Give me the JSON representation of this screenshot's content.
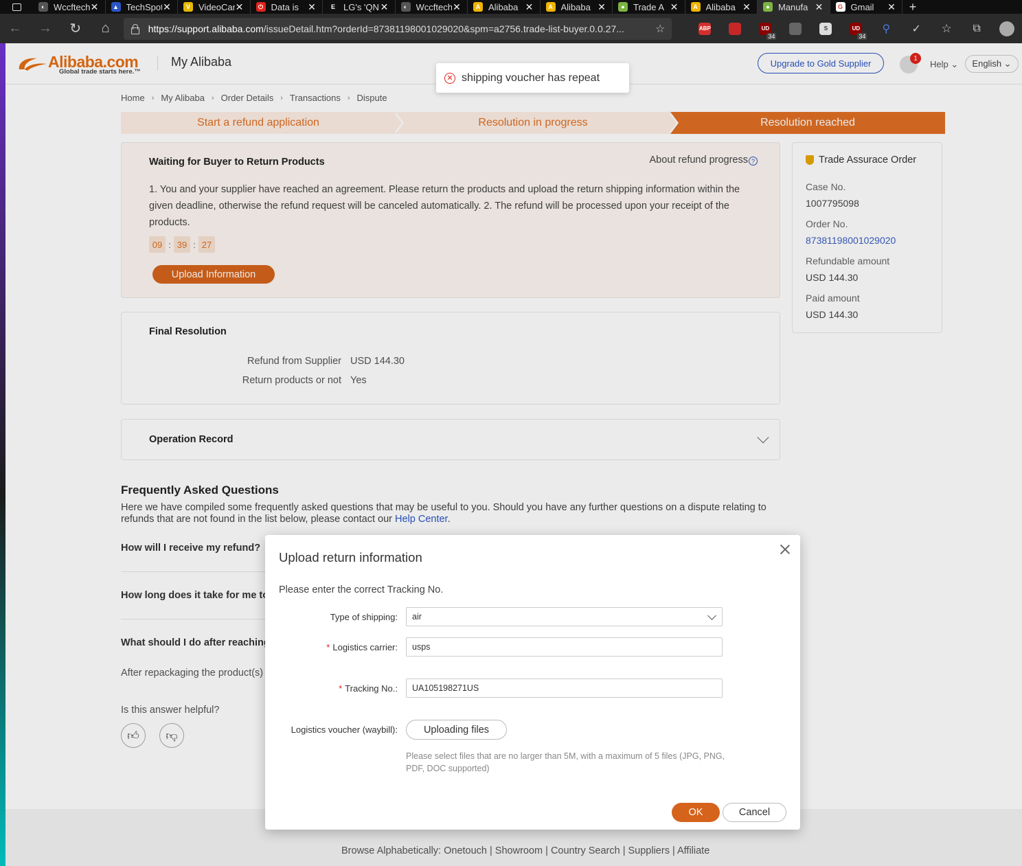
{
  "browser": {
    "tabs": [
      {
        "title": "Wccftech",
        "icon_color": "#555555",
        "glyph": "◐"
      },
      {
        "title": "TechSpot",
        "icon_color": "#2b55c3",
        "glyph": "▲"
      },
      {
        "title": "VideoCardz",
        "icon_color": "#e6b800",
        "glyph": "V"
      },
      {
        "title": "Data is",
        "icon_color": "#e2231a",
        "glyph": "⏻"
      },
      {
        "title": "LG's 'QNED'",
        "icon_color": "#111111",
        "glyph": "E"
      },
      {
        "title": "Wccftech",
        "icon_color": "#555555",
        "glyph": "◐"
      },
      {
        "title": "Alibaba",
        "icon_color": "#f0b400",
        "glyph": "A"
      },
      {
        "title": "Alibaba",
        "icon_color": "#f0b400",
        "glyph": "A"
      },
      {
        "title": "Trade A",
        "icon_color": "#7cb342",
        "glyph": "●"
      },
      {
        "title": "Alibaba",
        "icon_color": "#f0b400",
        "glyph": "A"
      },
      {
        "title": "Manufa",
        "icon_color": "#7cb342",
        "glyph": "●",
        "active": true
      },
      {
        "title": "Gmail",
        "icon_color": "#ffffff",
        "glyph": "G"
      }
    ],
    "url_host": "https://support.alibaba.com",
    "url_path": "/issueDetail.htm?orderId=87381198001029020&spm=a2756.trade-list-buyer.0.0.27...",
    "extensions": [
      {
        "name": "ABP",
        "color": "#d32f2f",
        "badge": ""
      },
      {
        "name": "",
        "color": "#c62828",
        "badge": ""
      },
      {
        "name": "UD",
        "color": "#8b0000",
        "badge": "34"
      },
      {
        "name": "",
        "color": "#666666",
        "badge": ""
      },
      {
        "name": "S",
        "color": "#dddddd",
        "badge": ""
      },
      {
        "name": "UD",
        "color": "#8b0000",
        "badge": "34"
      }
    ]
  },
  "header": {
    "logo_name": "Alibaba.com",
    "logo_tagline": "Global trade starts here.™",
    "section": "My Alibaba",
    "upgrade_button": "Upgrade to Gold Supplier",
    "notification_count": "1",
    "help": "Help ⌄",
    "language": "English ⌄"
  },
  "toast": {
    "message": "shipping voucher has repeat"
  },
  "breadcrumb": [
    "Home",
    "My Alibaba",
    "Order Details",
    "Transactions",
    "Dispute"
  ],
  "steps": [
    {
      "label": "Start a refund application",
      "done": false
    },
    {
      "label": "Resolution in progress",
      "done": false
    },
    {
      "label": "Resolution reached",
      "done": true
    }
  ],
  "waiting": {
    "title": "Waiting for Buyer to Return Products",
    "about": "About refund progress",
    "description": "1. You and your supplier have reached an agreement. Please return the products and upload the return shipping information within the given deadline, otherwise the refund request will be canceled automatically. 2. The refund will be processed upon your receipt of the products.",
    "timer": {
      "h": "09",
      "m": "39",
      "s": "27"
    },
    "upload_button": "Upload Information"
  },
  "order_side": {
    "title": "Trade Assurace Order",
    "case_label": "Case No.",
    "case_value": "1007795098",
    "order_label": "Order No.",
    "order_value": "87381198001029020",
    "refundable_label": "Refundable amount",
    "refundable_value": "USD 144.30",
    "paid_label": "Paid amount",
    "paid_value": "USD 144.30"
  },
  "final_resolution": {
    "title": "Final Resolution",
    "rows": [
      {
        "label": "Refund from Supplier",
        "value": "USD 144.30"
      },
      {
        "label": "Return products or not",
        "value": "Yes"
      }
    ]
  },
  "operation_record": {
    "title": "Operation Record"
  },
  "faq": {
    "title": "Frequently Asked Questions",
    "intro": "Here we have compiled some frequently asked questions that may be useful to you. Should you have any further questions on a dispute relating to refunds that are not found in the list below, please contact our ",
    "help_link": "Help Center",
    "intro_end": ".",
    "questions": [
      "How will I receive my refund?",
      "How long does it take for me to",
      "What should I do after reaching"
    ],
    "answer": "After repackaging the product(s) 'Disputes' page. After the supplie",
    "helpful": "Is this answer helpful?"
  },
  "footer": {
    "links": "Browse Alphabetically: Onetouch  |  Showroom  |  Country Search  |  Suppliers  |  Affiliate"
  },
  "modal": {
    "title": "Upload return information",
    "note": "Please enter the correct Tracking No.",
    "shipping_label": "Type of shipping:",
    "shipping_value": "air",
    "carrier_label": "Logistics carrier:",
    "carrier_value": "usps",
    "tracking_label": "Tracking No.:",
    "tracking_value": "UA105198271US",
    "voucher_label": "Logistics voucher (waybill):",
    "files_button": "Uploading files",
    "hint": "Please select files that are no larger than 5M, with a maximum of 5 files (JPG, PNG, PDF, DOC supported)",
    "ok": "OK",
    "cancel": "Cancel"
  }
}
